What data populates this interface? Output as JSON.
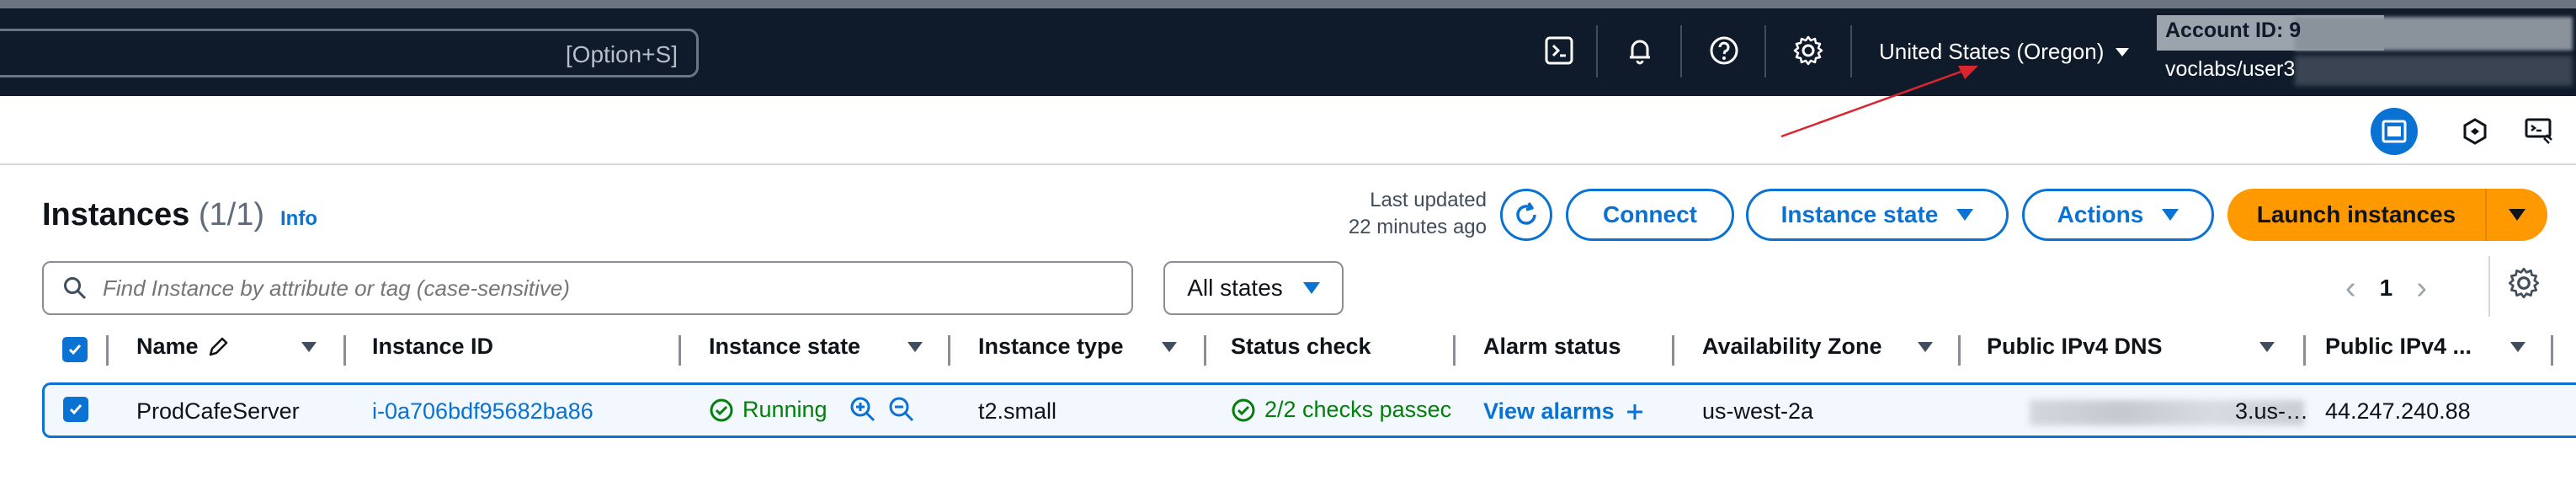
{
  "topnav": {
    "search_shortcut": "[Option+S]",
    "region": "United States (Oregon)",
    "account_id": "Account ID: 9",
    "user": "voclabs/user3"
  },
  "page": {
    "title": "Instances",
    "count": "(1/1)",
    "info_link": "Info",
    "last_updated": "Last updated",
    "last_updated_time": "22 minutes ago"
  },
  "actions": {
    "connect": "Connect",
    "instance_state": "Instance state",
    "actions": "Actions",
    "launch": "Launch instances"
  },
  "filter": {
    "placeholder": "Find Instance by attribute or tag (case-sensitive)",
    "states": "All states"
  },
  "pagination": {
    "current_page": "1"
  },
  "table": {
    "columns": [
      "Name",
      "Instance ID",
      "Instance state",
      "Instance type",
      "Status check",
      "Alarm status",
      "Availability Zone",
      "Public IPv4 DNS",
      "Public IPv4 ..."
    ],
    "row": {
      "name": "ProdCafeServer",
      "instance_id": "i-0a706bdf95682ba86",
      "state": "Running",
      "type": "t2.small",
      "status_check": "2/2 checks passec",
      "alarm": "View alarms",
      "zone": "us-west-2a",
      "dns_suffix": "3.us-…",
      "ipv4": "44.247.240.88"
    }
  },
  "colors": {
    "nav_bg": "#0f1b2a",
    "accent": "#0972d3",
    "launch": "#ff9900",
    "success": "#037f0c",
    "annotation_arrow": "#d9262e"
  }
}
